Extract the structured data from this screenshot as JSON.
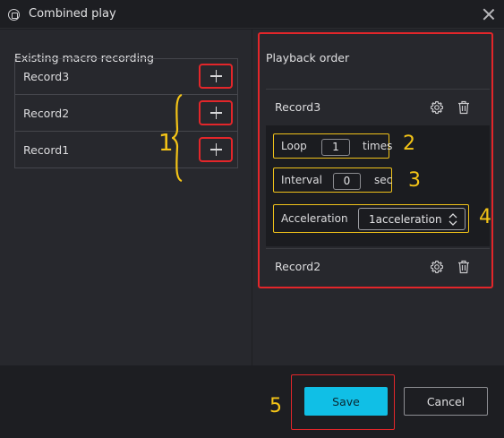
{
  "window": {
    "title": "Combined play",
    "title_icon": "window-logo-icon",
    "close_icon": "close-icon"
  },
  "left": {
    "heading": "Existing macro recording",
    "records": [
      {
        "name": "Record3",
        "action_icon": "plus-icon"
      },
      {
        "name": "Record2",
        "action_icon": "plus-icon"
      },
      {
        "name": "Record1",
        "action_icon": "plus-icon"
      }
    ]
  },
  "right": {
    "heading": "Playback order",
    "items": [
      {
        "name": "Record3",
        "icons": [
          "gear-icon",
          "trash-icon"
        ]
      },
      {
        "name": "Record2",
        "icons": [
          "gear-icon",
          "trash-icon"
        ]
      }
    ],
    "settings": {
      "loop_label": "Loop",
      "loop_value": "1",
      "loop_unit": "times",
      "interval_label": "Interval",
      "interval_value": "0",
      "interval_unit": "sec",
      "acceleration_label": "Acceleration",
      "acceleration_value": "1acceleration"
    }
  },
  "annotations": [
    "1",
    "2",
    "3",
    "4",
    "5"
  ],
  "footer": {
    "save_label": "Save",
    "cancel_label": "Cancel"
  },
  "colors": {
    "accent": "#10bfe6",
    "highlight_red": "#e3262a",
    "annotation_yellow": "#f4c417",
    "background": "#1d1e22",
    "panel": "#27282d"
  }
}
